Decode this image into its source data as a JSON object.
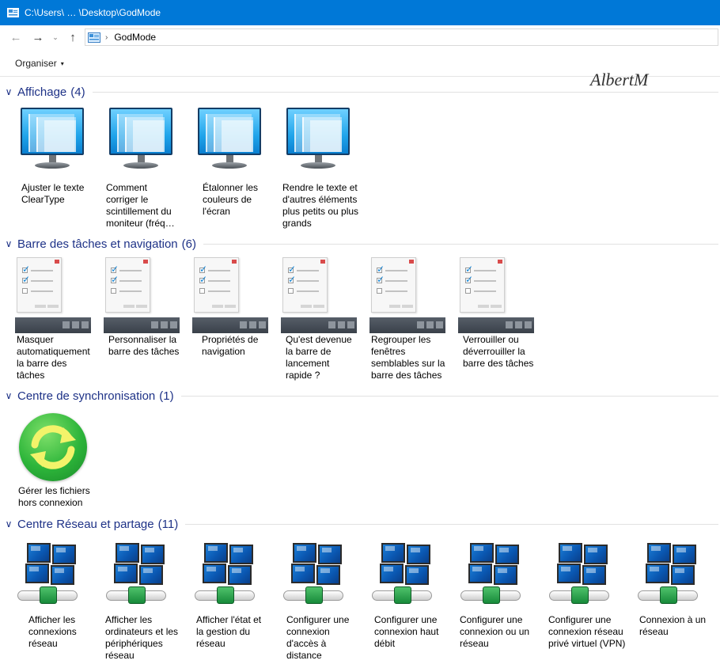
{
  "window": {
    "title": "C:\\Users\\ … \\Desktop\\GodMode"
  },
  "address": {
    "crumb": "GodMode",
    "separator": "›"
  },
  "nav": {
    "back": "←",
    "forward": "→",
    "recent": "⌄",
    "up": "↑"
  },
  "toolbar": {
    "organiser_label": "Organiser",
    "organiser_caret": "▾"
  },
  "watermark": "AlbertM",
  "colors": {
    "titlebar": "#0078d7",
    "group_header": "#1e3287"
  },
  "groups": [
    {
      "title": "Affichage",
      "count": "(4)",
      "chevron": "∨",
      "icon": "monitor-icon",
      "items": [
        {
          "label": "Ajuster le texte ClearType"
        },
        {
          "label": "Comment corriger le scintillement du moniteur (fréq…"
        },
        {
          "label": "Étalonner les couleurs de l'écran"
        },
        {
          "label": "Rendre le texte et d'autres éléments plus petits ou plus grands"
        }
      ]
    },
    {
      "title": "Barre des tâches et navigation",
      "count": "(6)",
      "chevron": "∨",
      "icon": "taskbar-settings-icon",
      "items": [
        {
          "label": "Masquer automatiquement la barre des tâches"
        },
        {
          "label": "Personnaliser la barre des tâches"
        },
        {
          "label": "Propriétés de navigation"
        },
        {
          "label": "Qu'est devenue la barre de lancement rapide ?"
        },
        {
          "label": "Regrouper les fenêtres semblables sur la barre des tâches"
        },
        {
          "label": "Verrouiller ou déverrouiller la barre des tâches"
        }
      ]
    },
    {
      "title": "Centre de synchronisation",
      "count": "(1)",
      "chevron": "∨",
      "icon": "sync-center-icon",
      "items": [
        {
          "label": "Gérer les fichiers hors connexion"
        }
      ]
    },
    {
      "title": "Centre Réseau et partage",
      "count": "(11)",
      "chevron": "∨",
      "icon": "network-icon",
      "items": [
        {
          "label": "Afficher les connexions réseau"
        },
        {
          "label": "Afficher les ordinateurs et les périphériques réseau"
        },
        {
          "label": "Afficher l'état et la gestion du réseau"
        },
        {
          "label": "Configurer une connexion d'accès à distance"
        },
        {
          "label": "Configurer une connexion haut débit"
        },
        {
          "label": "Configurer une connexion ou un réseau"
        },
        {
          "label": "Configurer une connexion réseau privé virtuel (VPN)"
        },
        {
          "label": "Connexion à un réseau"
        }
      ]
    }
  ]
}
